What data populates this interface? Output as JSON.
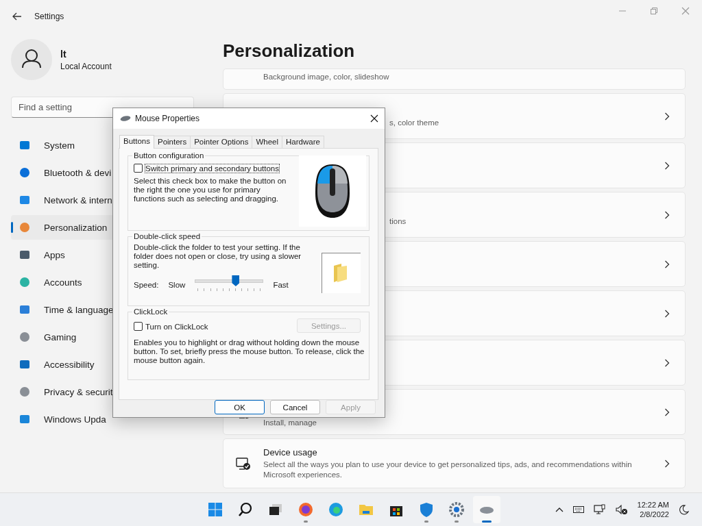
{
  "window": {
    "title": "Settings"
  },
  "account": {
    "name": "lt",
    "type": "Local Account"
  },
  "search": {
    "placeholder": "Find a setting"
  },
  "nav": [
    {
      "label": "System",
      "selected": false
    },
    {
      "label": "Bluetooth & devi",
      "selected": false
    },
    {
      "label": "Network & intern",
      "selected": false
    },
    {
      "label": "Personalization",
      "selected": true
    },
    {
      "label": "Apps",
      "selected": false
    },
    {
      "label": "Accounts",
      "selected": false
    },
    {
      "label": "Time & language",
      "selected": false
    },
    {
      "label": "Gaming",
      "selected": false
    },
    {
      "label": "Accessibility",
      "selected": false
    },
    {
      "label": "Privacy & securit",
      "selected": false
    },
    {
      "label": "Windows Upda",
      "selected": false
    }
  ],
  "page_title": "Personalization",
  "cards": [
    {
      "kind": "clipped",
      "description": "Background image, color, slideshow"
    },
    {
      "kind": "covered",
      "description": "s, color theme"
    },
    {
      "kind": "covered"
    },
    {
      "kind": "covered",
      "description": "tions"
    },
    {
      "kind": "covered"
    },
    {
      "kind": "covered"
    },
    {
      "kind": "covered"
    },
    {
      "kind": "plain",
      "description": "Install, manage"
    },
    {
      "kind": "plain",
      "title": "Device usage",
      "description": "Select all the ways you plan to use your device to get personalized tips, ads, and recommendations within Microsoft experiences."
    }
  ],
  "dialog": {
    "title": "Mouse Properties",
    "tabs": [
      {
        "label": "Buttons",
        "selected": true
      },
      {
        "label": "Pointers",
        "selected": false
      },
      {
        "label": "Pointer Options",
        "selected": false
      },
      {
        "label": "Wheel",
        "selected": false
      },
      {
        "label": "Hardware",
        "selected": false
      }
    ],
    "button_config": {
      "legend": "Button configuration",
      "checkbox": {
        "label": "Switch primary and secondary buttons",
        "checked": false
      },
      "description": "Select this check box to make the button on the right the one you use for primary functions such as selecting and dragging."
    },
    "double_click": {
      "legend": "Double-click speed",
      "description": "Double-click the folder to test your setting. If the folder does not open or close, try using a slower setting.",
      "speed_label": "Speed:",
      "slow": "Slow",
      "fast": "Fast",
      "level": 0.59
    },
    "clicklock": {
      "legend": "ClickLock",
      "checkbox": {
        "label": "Turn on ClickLock",
        "checked": false
      },
      "settings_button": {
        "label": "Settings...",
        "disabled": true
      },
      "description": "Enables you to highlight or drag without holding down the mouse button. To set, briefly press the mouse button. To release, click the mouse button again."
    },
    "buttons": [
      {
        "label": "OK",
        "default": true,
        "disabled": false
      },
      {
        "label": "Cancel",
        "default": false,
        "disabled": false
      },
      {
        "label": "Apply",
        "default": false,
        "disabled": true
      }
    ]
  },
  "taskbar": {
    "apps": [
      {
        "running": false,
        "active": false
      },
      {
        "running": false,
        "active": false
      },
      {
        "running": false,
        "active": false
      },
      {
        "running": true,
        "active": false
      },
      {
        "running": false,
        "active": false
      },
      {
        "running": false,
        "active": false
      },
      {
        "running": false,
        "active": false
      },
      {
        "running": true,
        "active": false
      },
      {
        "running": true,
        "active": false
      },
      {
        "running": true,
        "active": true
      }
    ],
    "time": "12:22 AM",
    "date": "2/8/2022"
  }
}
